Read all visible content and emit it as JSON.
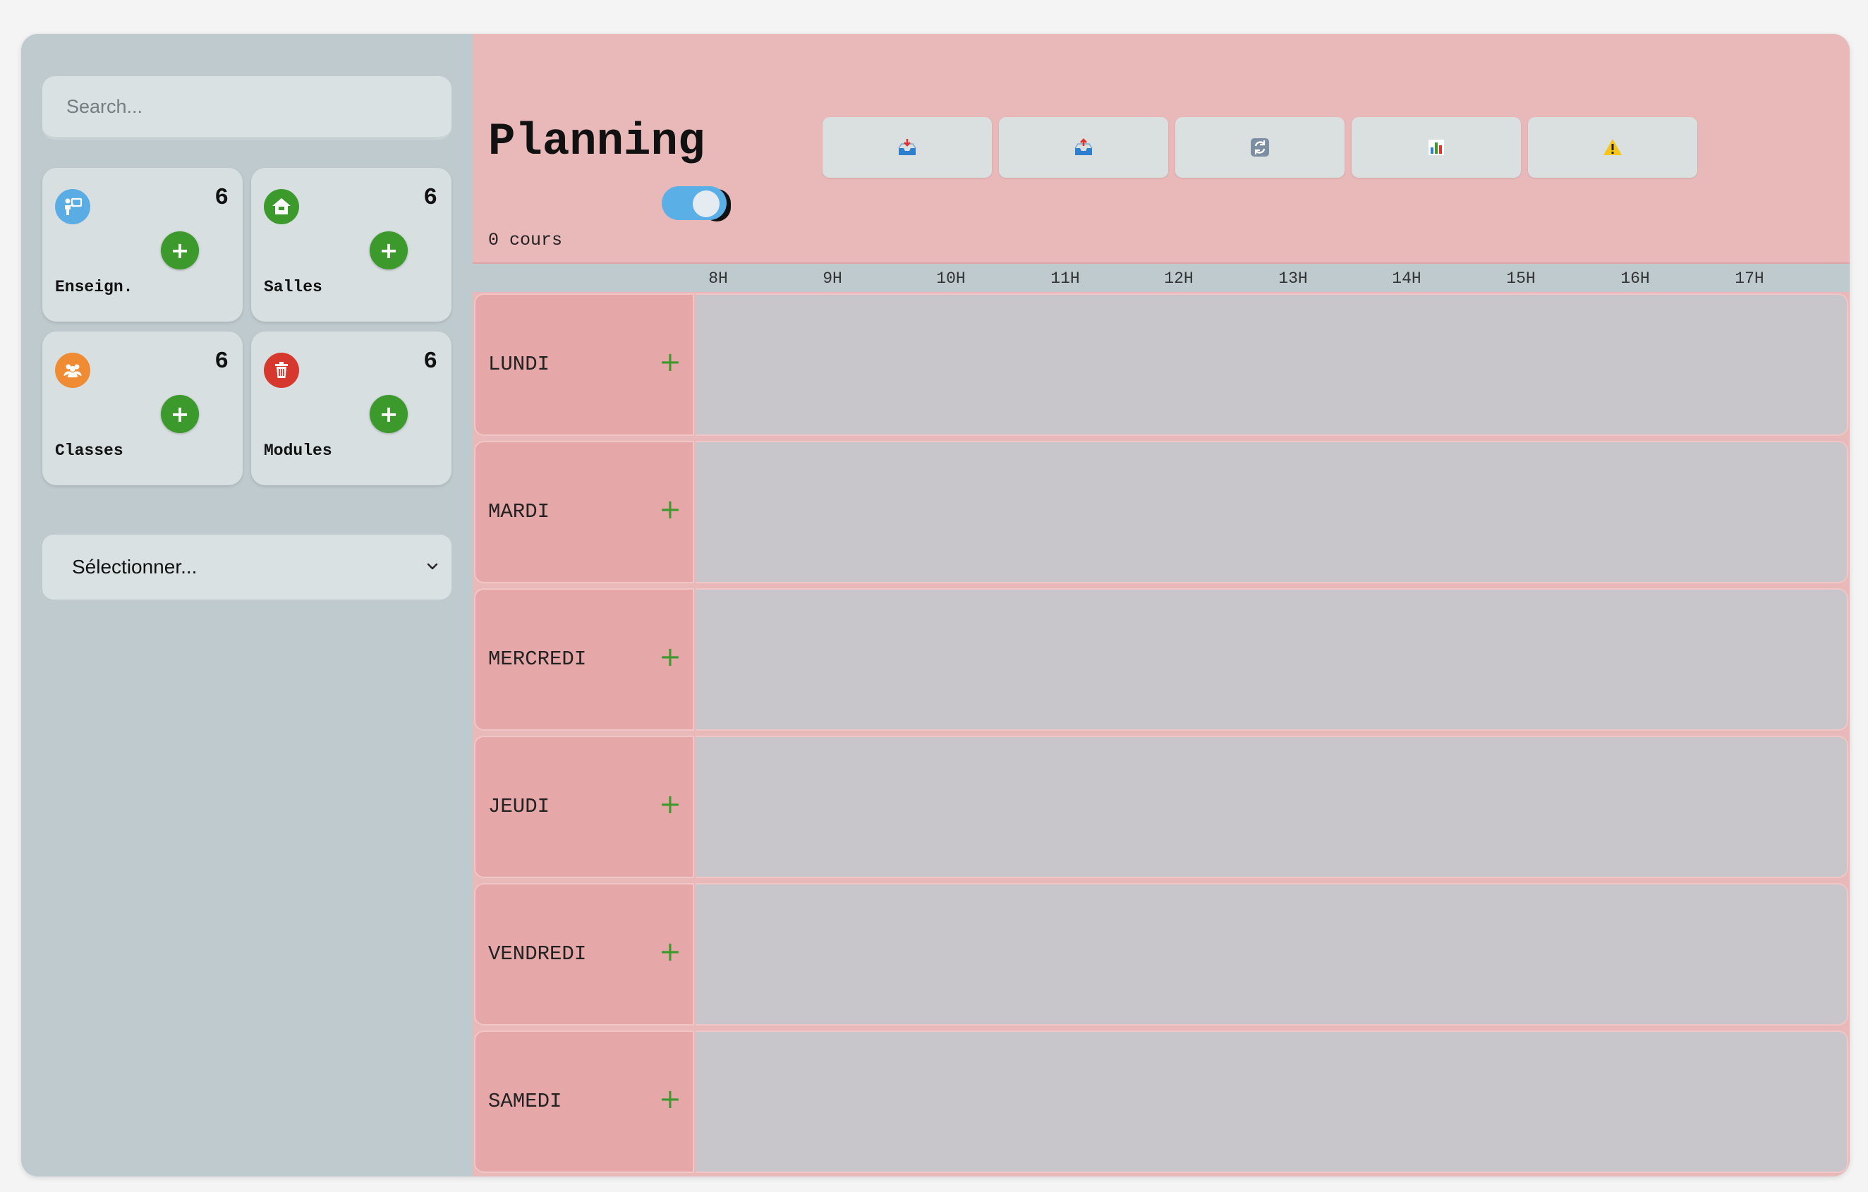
{
  "sidebar": {
    "search_placeholder": "Search...",
    "cards": [
      {
        "label": "Enseign.",
        "count": "6",
        "icon": "teacher-icon",
        "color": "#5aace4"
      },
      {
        "label": "Salles",
        "count": "6",
        "icon": "home-icon",
        "color": "#3c9a2c"
      },
      {
        "label": "Classes",
        "count": "6",
        "icon": "group-icon",
        "color": "#ef8b33"
      },
      {
        "label": "Modules",
        "count": "6",
        "icon": "trash-icon",
        "color": "#d6382d"
      }
    ],
    "add_label": "+",
    "select_value": "Sélectionner..."
  },
  "main": {
    "title": "Planning",
    "toolbar": [
      {
        "icon": "inbox-tray-icon"
      },
      {
        "icon": "outbox-tray-icon"
      },
      {
        "icon": "refresh-icon"
      },
      {
        "icon": "bar-chart-icon"
      },
      {
        "icon": "warning-icon"
      }
    ],
    "toggle_on": true,
    "course_count": "0 cours",
    "hours": [
      "8H",
      "9H",
      "10H",
      "11H",
      "12H",
      "13H",
      "14H",
      "15H",
      "16H",
      "17H"
    ],
    "days": [
      "LUNDI",
      "MARDI",
      "MERCREDI",
      "JEUDI",
      "VENDREDI",
      "SAMEDI"
    ],
    "add_label": "+"
  }
}
